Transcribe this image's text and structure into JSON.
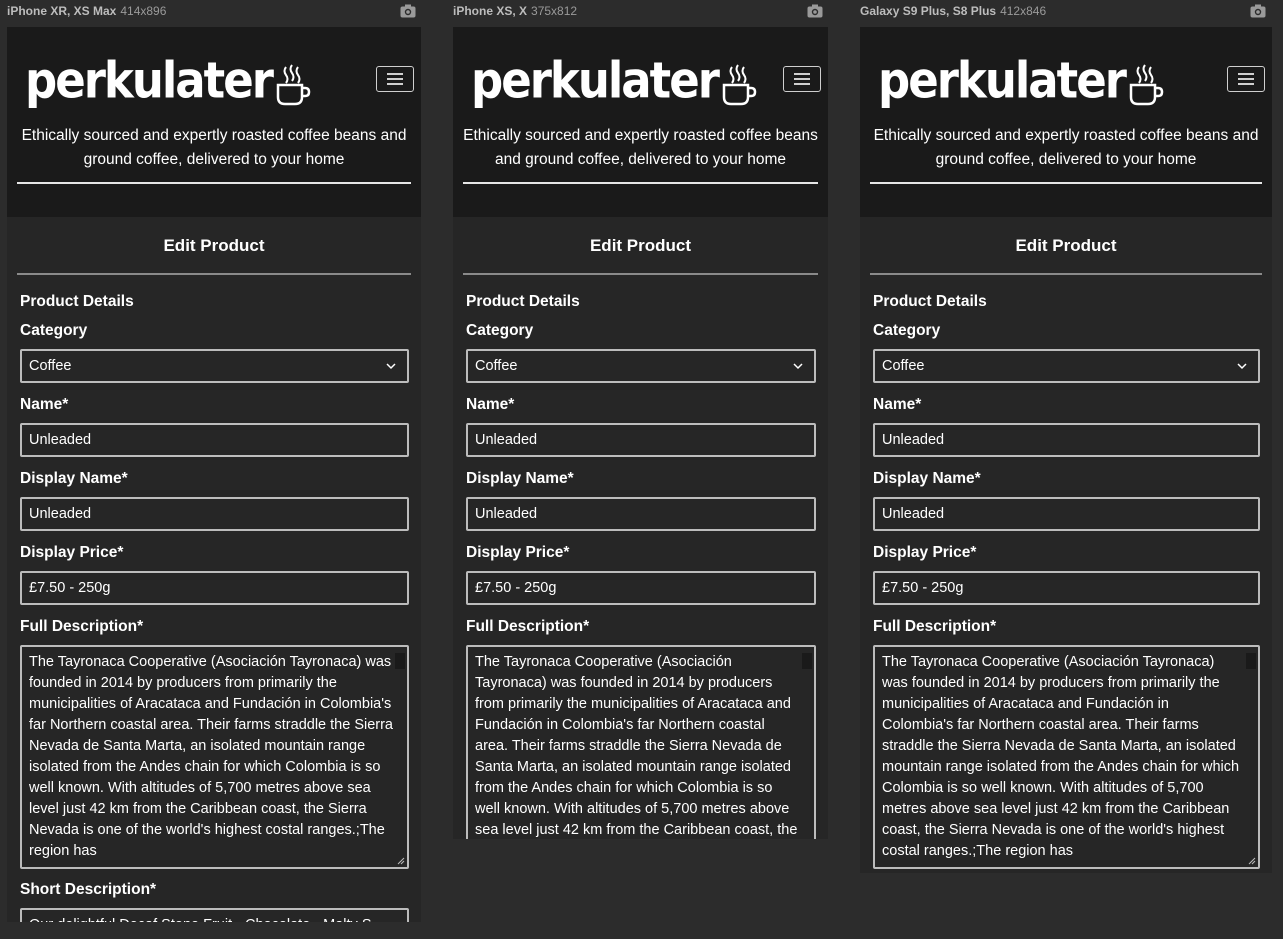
{
  "devices": [
    {
      "name": "iPhone XR, XS Max",
      "dims": "414x896"
    },
    {
      "name": "iPhone XS, X",
      "dims": "375x812"
    },
    {
      "name": "Galaxy S9 Plus, S8 Plus",
      "dims": "412x846"
    }
  ],
  "site": {
    "logo_text": "perkulater",
    "tagline": "Ethically sourced and expertly roasted coffee beans and ground coffee, delivered to your home",
    "menu_icon": "hamburger-icon",
    "logo_icon": "coffee-cup-icon"
  },
  "page": {
    "title": "Edit Product"
  },
  "form": {
    "section_heading": "Product Details",
    "category": {
      "label": "Category",
      "value": "Coffee"
    },
    "name": {
      "label": "Name*",
      "value": "Unleaded"
    },
    "display_name": {
      "label": "Display Name*",
      "value": "Unleaded"
    },
    "display_price": {
      "label": "Display Price*",
      "value": "£7.50 - 250g"
    },
    "full_description": {
      "label": "Full Description*",
      "value": "The Tayronaca Cooperative (Asociación Tayronaca) was founded in 2014 by producers from primarily the municipalities of Aracataca and Fundación in Colombia's far Northern coastal area. Their farms straddle the Sierra Nevada de Santa Marta, an isolated mountain range isolated from the Andes chain for which Colombia is so well known. With altitudes of 5,700 metres above sea level just 42 km from the Caribbean coast, the Sierra Nevada is one of the world's highest costal ranges.;The region has"
    },
    "short_description": {
      "label": "Short Description*",
      "value": "Our delightful Decaf Stone Fruit - Chocolate - Malty S"
    }
  },
  "colors": {
    "background": "#2c2c2c",
    "header": "#1a1a1a",
    "page": "#262626",
    "text": "#ffffff"
  }
}
